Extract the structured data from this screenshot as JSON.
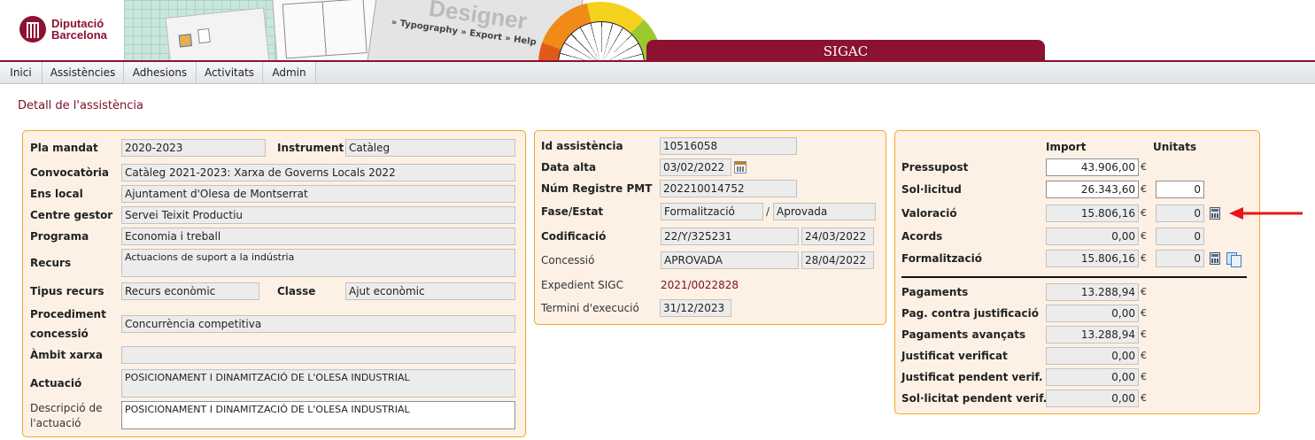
{
  "brand": {
    "line1": "Diputació",
    "line2": "Barcelona"
  },
  "header": {
    "app_title": "SIGAC",
    "collage_designer": "Designer",
    "collage_links": "» Typography  » Export  » Help"
  },
  "menu": {
    "items": [
      "Inici",
      "Assistències",
      "Adhesions",
      "Activitats",
      "Admin"
    ]
  },
  "page": {
    "title": "Detall de l'assistència"
  },
  "left": {
    "pla_mandat_label": "Pla mandat",
    "pla_mandat": "2020-2023",
    "instrument_label": "Instrument",
    "instrument": "Catàleg",
    "convocatoria_label": "Convocatòria",
    "convocatoria": "Catàleg 2021-2023: Xarxa de Governs Locals 2022",
    "ens_local_label": "Ens local",
    "ens_local": "Ajuntament d'Olesa de Montserrat",
    "centre_gestor_label": "Centre gestor",
    "centre_gestor": "Servei Teixit Productiu",
    "programa_label": "Programa",
    "programa": "Economia i treball",
    "recurs_label": "Recurs",
    "recurs": "Actuacions de suport a la indústria",
    "tipus_recurs_label": "Tipus recurs",
    "tipus_recurs": "Recurs econòmic",
    "classe_label": "Classe",
    "classe": "Ajut econòmic",
    "procediment_label_1": "Procediment",
    "procediment_label_2": "concessió",
    "procediment": "Concurrència competitiva",
    "ambit_label": "Àmbit xarxa",
    "ambit": "",
    "actuacio_label": "Actuació",
    "actuacio": "POSICIONAMENT I DINAMITZACIÓ DE L'OLESA INDUSTRIAL",
    "descripcio_label_1": "Descripció de",
    "descripcio_label_2": "l'actuació",
    "descripcio": "POSICIONAMENT I DINAMITZACIÓ DE L'OLESA INDUSTRIAL"
  },
  "middle": {
    "id_label": "Id assistència",
    "id": "10516058",
    "data_alta_label": "Data alta",
    "data_alta": "03/02/2022",
    "registre_label": "Núm Registre PMT",
    "registre": "202210014752",
    "fase_label": "Fase/Estat",
    "fase": "Formalització",
    "fase_sep": "/",
    "estat": "Aprovada",
    "codificacio_label": "Codificació",
    "codificacio": "22/Y/325231",
    "codificacio_data": "24/03/2022",
    "concessio_label": "Concessió",
    "concessio": "APROVADA",
    "concessio_data": "28/04/2022",
    "expedient_label": "Expedient SIGC",
    "expedient": "2021/0022828",
    "termini_label": "Termini d'execució",
    "termini": "31/12/2023"
  },
  "right": {
    "import_header": "Import",
    "unitats_header": "Unitats",
    "currency": "€",
    "rows": [
      {
        "label": "Pressupost",
        "import": "43.906,00",
        "unitats": ""
      },
      {
        "label": "Sol·licitud",
        "import": "26.343,60",
        "unitats": "0"
      },
      {
        "label": "Valoració",
        "import": "15.806,16",
        "unitats": "0"
      },
      {
        "label": "Acords",
        "import": "0,00",
        "unitats": "0"
      },
      {
        "label": "Formalització",
        "import": "15.806,16",
        "unitats": "0"
      }
    ],
    "payments": [
      {
        "label": "Pagaments",
        "import": "13.288,94"
      },
      {
        "label": "Pag. contra justificació",
        "import": "0,00"
      },
      {
        "label": "Pagaments avançats",
        "import": "13.288,94"
      },
      {
        "label": "Justificat verificat",
        "import": "0,00"
      },
      {
        "label": "Justificat pendent verif.",
        "import": "0,00"
      },
      {
        "label": "Sol·licitat pendent verif.",
        "import": "0,00"
      }
    ]
  },
  "colors": {
    "brand": "#8b1230",
    "panel_bg": "#fdf1e6",
    "panel_border": "#f3a81d",
    "arrow": "#e8151b"
  }
}
